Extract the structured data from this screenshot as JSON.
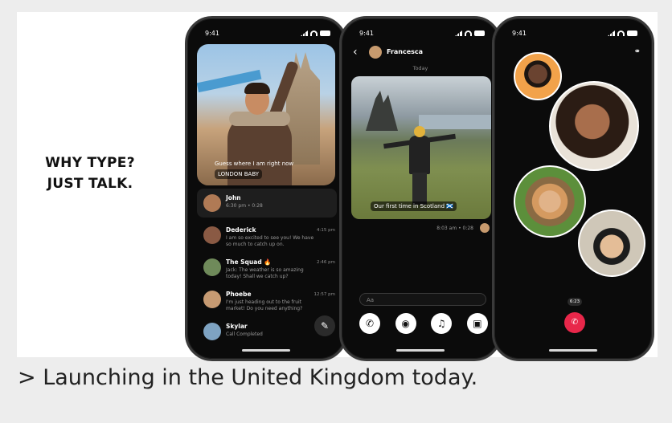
{
  "tagline": {
    "line1": "WHY TYPE?",
    "line2": "JUST TALK."
  },
  "caption": "> Launching in the United Kingdom today.",
  "phone1": {
    "time": "9:41",
    "hero": {
      "message": "Guess where I am right now",
      "tag": "LONDON BABY"
    },
    "chats": [
      {
        "name": "John",
        "sub": "6:30 pm • 0:28",
        "time": ""
      },
      {
        "name": "Dederick",
        "sub": "I am so excited to see you! We have so much to catch up on.",
        "time": "4:15 pm"
      },
      {
        "name": "The Squad 🔥",
        "sub": "Jack: The weather is so amazing today! Shall we catch up?",
        "time": "2:46 pm"
      },
      {
        "name": "Phoebe",
        "sub": "I'm just heading out to the fruit market! Do you need anything?",
        "time": "12:57 pm"
      },
      {
        "name": "Skylar",
        "sub": "Call Completed",
        "time": ""
      }
    ]
  },
  "phone2": {
    "time": "9:41",
    "contact": "Francesca",
    "day": "Today",
    "photo_caption": "Our first time in Scotland 🏴󠁧󠁢󠁳󠁣󠁴󠁿",
    "meta": "8:03 am • 0:28",
    "input_placeholder": "Aa"
  },
  "phone3": {
    "time": "9:41",
    "timer": "6:23"
  }
}
